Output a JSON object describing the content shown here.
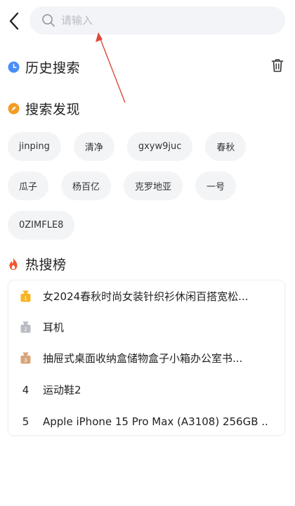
{
  "search": {
    "placeholder": "请输入"
  },
  "history": {
    "title": "历史搜索"
  },
  "discover": {
    "title": "搜索发现",
    "rows": [
      [
        "jinping",
        "清净",
        "gxyw9juc",
        "春秋"
      ],
      [
        "瓜子",
        "杨百亿",
        "克罗地亚",
        "一号"
      ],
      [
        "0ZIMFLE8"
      ]
    ]
  },
  "hot": {
    "title": "热搜榜",
    "items": [
      {
        "rank": "1",
        "text": "女2024春秋时尚女装针织衫休闲百搭宽松..."
      },
      {
        "rank": "2",
        "text": "耳机"
      },
      {
        "rank": "3",
        "text": "抽屉式桌面收纳盒储物盒子小箱办公室书..."
      },
      {
        "rank": "4",
        "text": "运动鞋2"
      },
      {
        "rank": "5",
        "text": "Apple iPhone 15 Pro Max (A3108) 256GB ..."
      }
    ]
  },
  "colors": {
    "history_icon": "#4a8df8",
    "discover_icon": "#f39c24",
    "hot_icon": "#f2552c",
    "medal_gold": "#f7b623",
    "medal_silver": "#b9bcc2",
    "medal_bronze": "#d8a47a",
    "annotation": "#d94a3a"
  },
  "icons": {
    "back": "chevron-left-icon",
    "search": "magnifier-icon",
    "history": "clock-icon",
    "discover": "compass-icon",
    "hot": "flame-icon",
    "trash": "trash-icon",
    "medals": [
      "gold-medal-icon",
      "silver-medal-icon",
      "bronze-medal-icon"
    ]
  }
}
